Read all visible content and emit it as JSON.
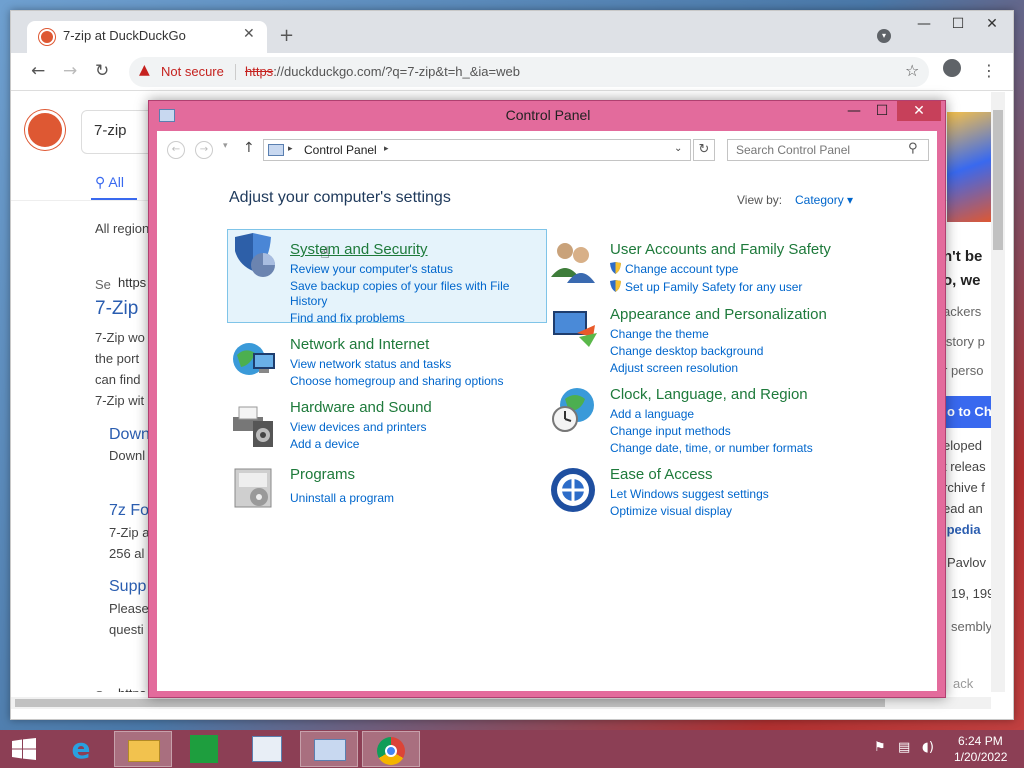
{
  "browser": {
    "tab_title": "7-zip at DuckDuckGo",
    "tab_close": "✕",
    "new_tab": "+",
    "not_secure": "Not secure",
    "url_scheme": "https",
    "url_rest": "://duckduckgo.com/?q=7-zip&t=h_&ia=web",
    "min": "—",
    "max": "☐",
    "close": "✕"
  },
  "ddg": {
    "query": "7-zip",
    "tab_all": "All",
    "all_regions": "All region",
    "result1_site": "https",
    "result1_prefix": "Se",
    "result1_title": "7-Zip",
    "result1_lines": [
      "7-Zip wo",
      "the port",
      "can find",
      "7-Zip wit"
    ],
    "result2_title": "Down",
    "result2_line": "Downl",
    "result3_title": "7z Fo",
    "result3_lines": [
      "7-Zip a",
      "256 al"
    ],
    "result4_title": "Supp",
    "result4_lines": [
      "Please",
      "questi"
    ],
    "result5_site": "https",
    "result5_prefix": "Se",
    "right_lines": [
      "n't be",
      "o, we",
      "ackers",
      "istory p",
      "r perso"
    ],
    "right_button": "o to Ch",
    "right_lines2": [
      "eloped",
      "t releas",
      "rchive f",
      "ead an"
    ],
    "right_link": "ipedia",
    "right_lines3": [
      "Pavlov",
      "19, 199",
      "sembly"
    ],
    "right_back": "ack"
  },
  "control_panel": {
    "title": "Control Panel",
    "min": "—",
    "max": "☐",
    "close": "✕",
    "address": "Control Panel",
    "search_placeholder": "Search Control Panel",
    "heading": "Adjust your computer's settings",
    "view_by_label": "View by:",
    "view_by_value": "Category ▾",
    "categories": [
      {
        "title": "System and Security",
        "links": [
          "Review your computer's status",
          "Save backup copies of your files with File",
          "History",
          "Find and fix problems"
        ]
      },
      {
        "title": "Network and Internet",
        "links": [
          "View network status and tasks",
          "Choose homegroup and sharing options"
        ]
      },
      {
        "title": "Hardware and Sound",
        "links": [
          "View devices and printers",
          "Add a device"
        ]
      },
      {
        "title": "Programs",
        "links": [
          "Uninstall a program"
        ]
      },
      {
        "title": "User Accounts and Family Safety",
        "links": [
          "Change account type",
          "Set up Family Safety for any user"
        ]
      },
      {
        "title": "Appearance and Personalization",
        "links": [
          "Change the theme",
          "Change desktop background",
          "Adjust screen resolution"
        ]
      },
      {
        "title": "Clock, Language, and Region",
        "links": [
          "Add a language",
          "Change input methods",
          "Change date, time, or number formats"
        ]
      },
      {
        "title": "Ease of Access",
        "links": [
          "Let Windows suggest settings",
          "Optimize visual display"
        ]
      }
    ]
  },
  "taskbar": {
    "time": "6:24 PM",
    "date": "1/20/2022"
  },
  "colors": {
    "window_frame": "#e36b9c",
    "taskbar": "#8c3f55",
    "category_title": "#1e7a3b",
    "link": "#0066cc",
    "ddg_orange": "#de5833"
  }
}
